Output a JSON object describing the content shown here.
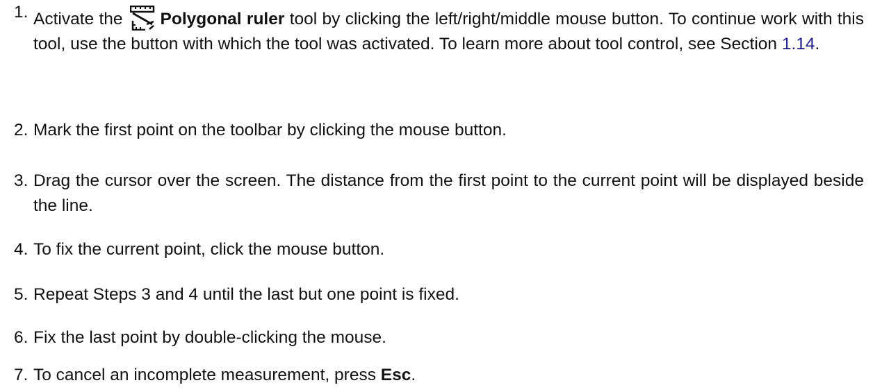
{
  "steps": [
    {
      "number": "1.",
      "before_icon": "Activate the",
      "icon": "polygonal-ruler-icon",
      "tool_name": "Polygonal ruler",
      "after_tool": " tool by clicking the left/right/middle mouse button. To continue work with this tool, use the button with which the tool was activated. To learn more about tool control, see Section ",
      "section_link": "1.14",
      "end": "."
    },
    {
      "number": "2.",
      "text": "Mark the first point on the toolbar by clicking the mouse button."
    },
    {
      "number": "3.",
      "text": "Drag the cursor over the screen. The distance from the first point to the current point will be displayed beside the line."
    },
    {
      "number": "4.",
      "text": "To fix the current point, click the mouse button."
    },
    {
      "number": "5.",
      "text": "Repeat Steps 3 and 4 until the last but one point is fixed."
    },
    {
      "number": "6.",
      "text": "Fix the last point by double-clicking the mouse."
    },
    {
      "number": "7.",
      "before_key": "To cancel an incomplete measurement, press ",
      "key": "Esc",
      "end": "."
    }
  ],
  "colors": {
    "text": "#111111",
    "link": "#1a1a8c"
  }
}
